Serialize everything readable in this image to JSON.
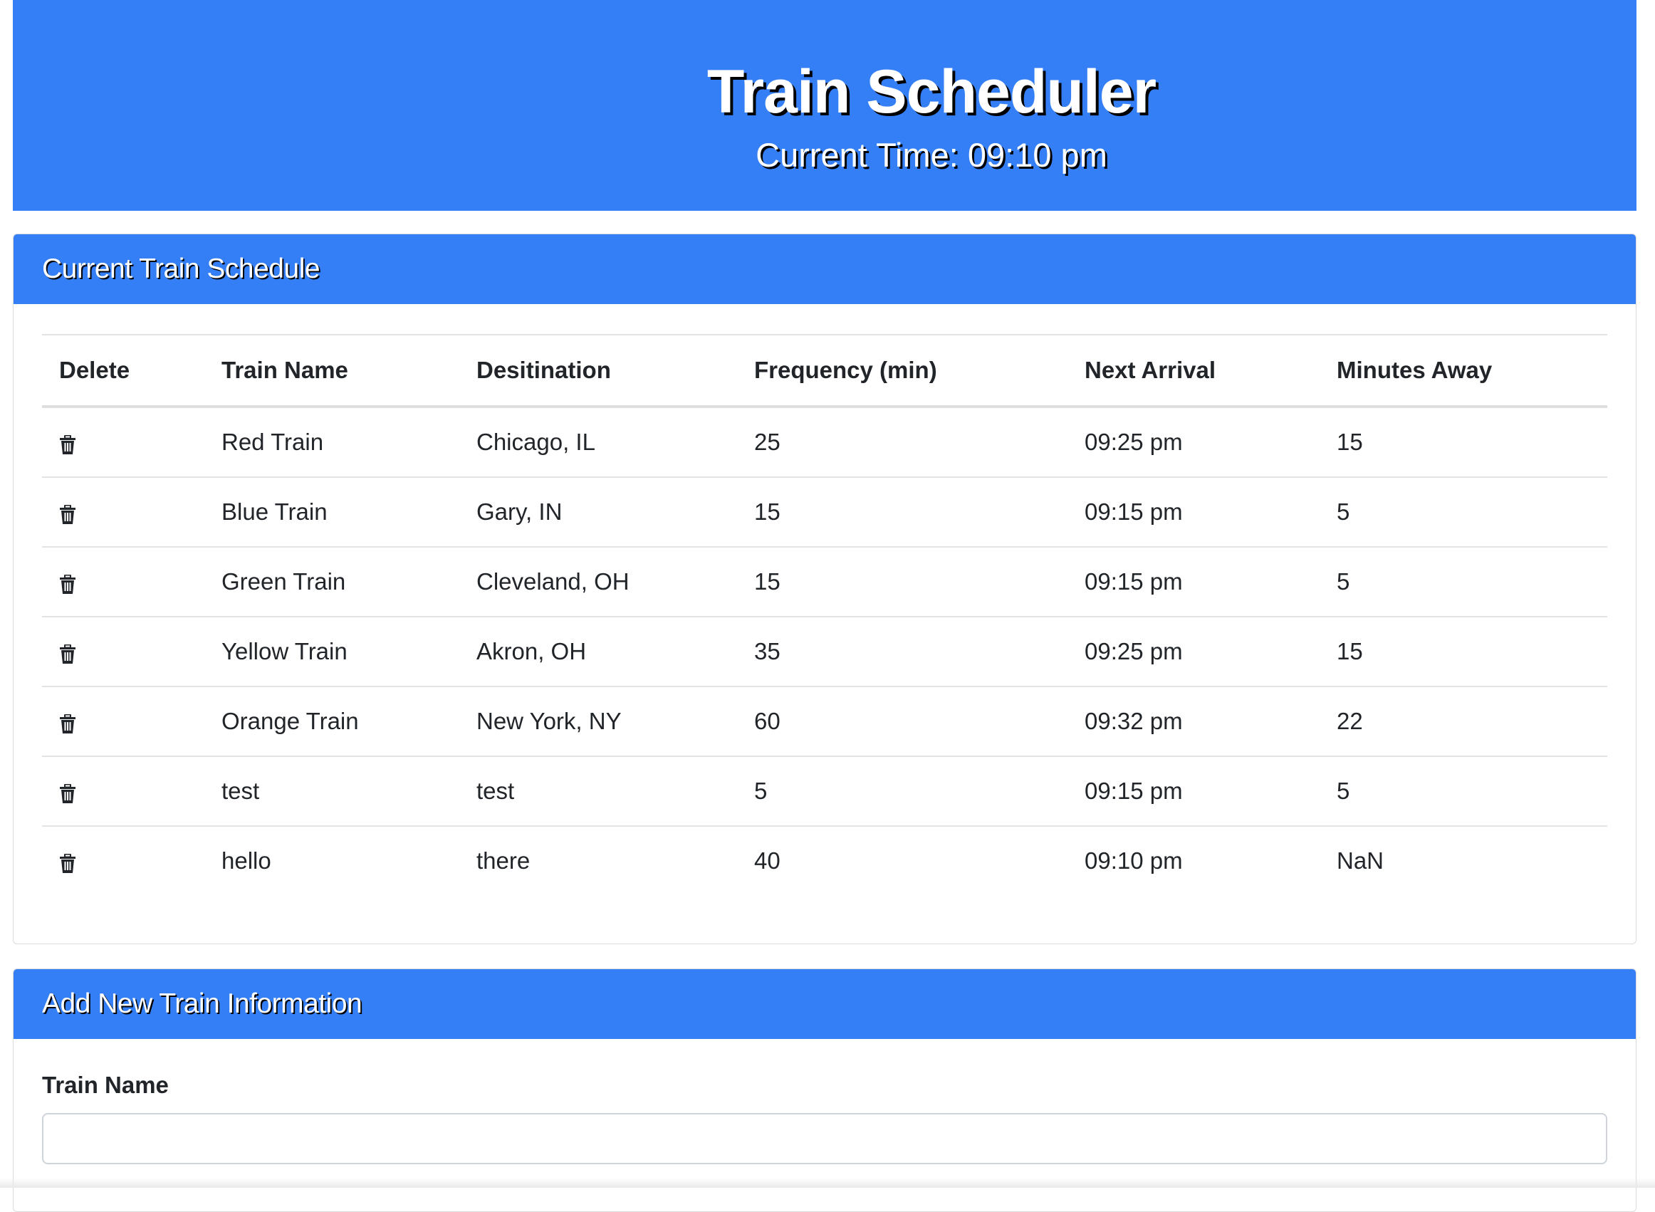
{
  "header": {
    "title": "Train Scheduler",
    "current_time": "Current Time: 09:10 pm"
  },
  "schedule": {
    "title": "Current Train Schedule",
    "columns": [
      "Delete",
      "Train Name",
      "Desitination",
      "Frequency (min)",
      "Next Arrival",
      "Minutes Away"
    ],
    "rows": [
      {
        "name": "Red Train",
        "destination": "Chicago, IL",
        "frequency": "25",
        "next_arrival": "09:25 pm",
        "minutes_away": "15"
      },
      {
        "name": "Blue Train",
        "destination": "Gary, IN",
        "frequency": "15",
        "next_arrival": "09:15 pm",
        "minutes_away": "5"
      },
      {
        "name": "Green Train",
        "destination": "Cleveland, OH",
        "frequency": "15",
        "next_arrival": "09:15 pm",
        "minutes_away": "5"
      },
      {
        "name": "Yellow Train",
        "destination": "Akron, OH",
        "frequency": "35",
        "next_arrival": "09:25 pm",
        "minutes_away": "15"
      },
      {
        "name": "Orange Train",
        "destination": "New York, NY",
        "frequency": "60",
        "next_arrival": "09:32 pm",
        "minutes_away": "22"
      },
      {
        "name": "test",
        "destination": "test",
        "frequency": "5",
        "next_arrival": "09:15 pm",
        "minutes_away": "5"
      },
      {
        "name": "hello",
        "destination": "there",
        "frequency": "40",
        "next_arrival": "09:10 pm",
        "minutes_away": "NaN"
      }
    ],
    "delete_icon": "trash-icon"
  },
  "add_form": {
    "title": "Add New Train Information",
    "train_name_label": "Train Name",
    "train_name_value": "",
    "train_name_placeholder": ""
  },
  "colors": {
    "accent": "#347ff5",
    "text": "#212529"
  }
}
